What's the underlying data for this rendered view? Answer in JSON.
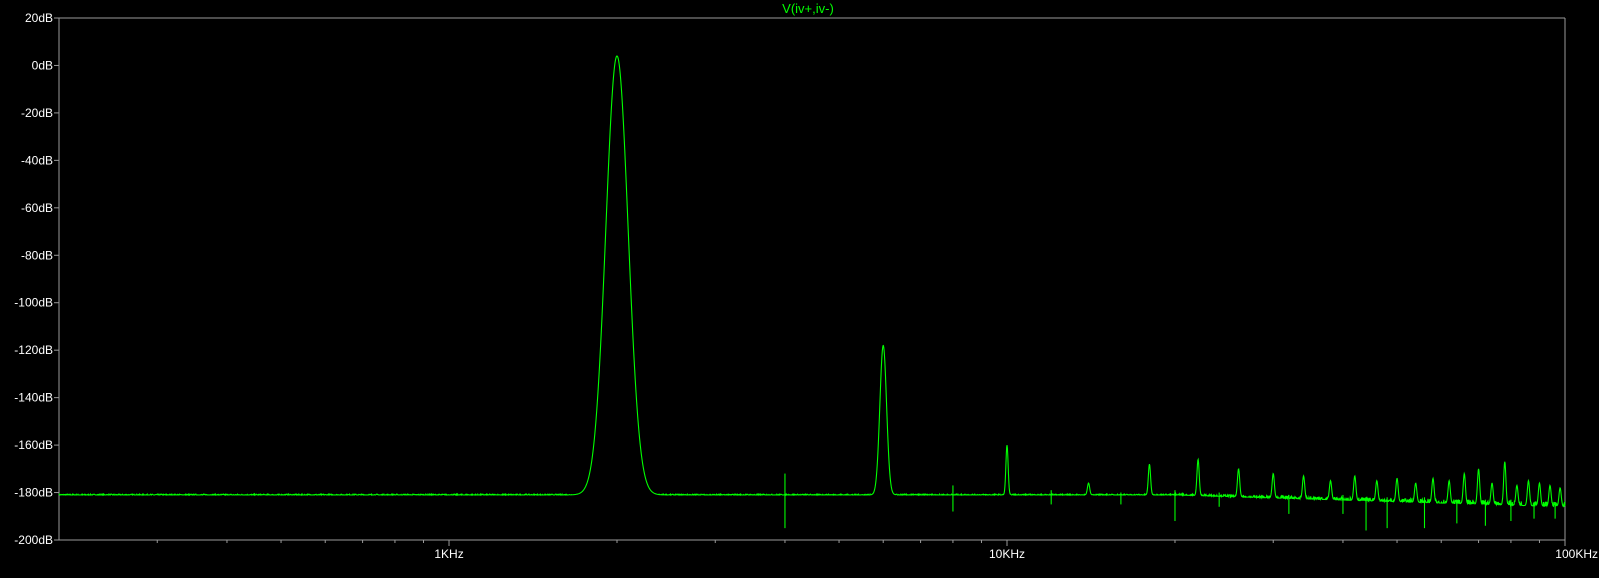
{
  "chart_data": {
    "type": "line",
    "title": "V(iv+,iv-)",
    "x_scale": "log",
    "xlim_hz": [
      200,
      100000
    ],
    "ylim_db": [
      -200,
      20
    ],
    "y_ticks": [
      {
        "value": 20,
        "label": "20dB"
      },
      {
        "value": 0,
        "label": "0dB"
      },
      {
        "value": -20,
        "label": "-20dB"
      },
      {
        "value": -40,
        "label": "-40dB"
      },
      {
        "value": -60,
        "label": "-60dB"
      },
      {
        "value": -80,
        "label": "-80dB"
      },
      {
        "value": -100,
        "label": "-100dB"
      },
      {
        "value": -120,
        "label": "-120dB"
      },
      {
        "value": -140,
        "label": "-140dB"
      },
      {
        "value": -160,
        "label": "-160dB"
      },
      {
        "value": -180,
        "label": "-180dB"
      },
      {
        "value": -200,
        "label": "-200dB"
      }
    ],
    "x_ticks": [
      {
        "value": 1000,
        "label": "1KHz"
      },
      {
        "value": 10000,
        "label": "10KHz"
      },
      {
        "value": 100000,
        "label": "100KHz"
      }
    ],
    "x_minor_ticks": [
      300,
      400,
      500,
      600,
      700,
      800,
      900,
      2000,
      3000,
      4000,
      5000,
      6000,
      7000,
      8000,
      9000,
      20000,
      30000,
      40000,
      50000,
      60000,
      70000,
      80000,
      90000
    ],
    "noise_floor_db": -181,
    "noise_floor_end_db": -186,
    "series_color": "#00ff00",
    "axis_color": "#9a9a9a",
    "label_color": "#ffffff",
    "grid": false,
    "peaks": [
      {
        "freq": 2000,
        "db": 4,
        "width": 0.02
      },
      {
        "freq": 6000,
        "db": -118,
        "width": 0.006
      },
      {
        "freq": 10000,
        "db": -160,
        "width": 0.002
      },
      {
        "freq": 14000,
        "db": -176,
        "width": 0.002
      },
      {
        "freq": 18000,
        "db": -168,
        "width": 0.002
      },
      {
        "freq": 22000,
        "db": -166,
        "width": 0.002
      },
      {
        "freq": 26000,
        "db": -170,
        "width": 0.002
      },
      {
        "freq": 30000,
        "db": -172,
        "width": 0.002
      },
      {
        "freq": 34000,
        "db": -173,
        "width": 0.002
      },
      {
        "freq": 38000,
        "db": -175,
        "width": 0.002
      },
      {
        "freq": 42000,
        "db": -173,
        "width": 0.002
      },
      {
        "freq": 46000,
        "db": -175,
        "width": 0.002
      },
      {
        "freq": 50000,
        "db": -174,
        "width": 0.002
      },
      {
        "freq": 54000,
        "db": -176,
        "width": 0.002
      },
      {
        "freq": 58000,
        "db": -174,
        "width": 0.002
      },
      {
        "freq": 62000,
        "db": -175,
        "width": 0.002
      },
      {
        "freq": 66000,
        "db": -172,
        "width": 0.002
      },
      {
        "freq": 70000,
        "db": -170,
        "width": 0.002
      },
      {
        "freq": 74000,
        "db": -176,
        "width": 0.002
      },
      {
        "freq": 78000,
        "db": -167,
        "width": 0.002
      },
      {
        "freq": 82000,
        "db": -177,
        "width": 0.002
      },
      {
        "freq": 86000,
        "db": -175,
        "width": 0.002
      },
      {
        "freq": 90000,
        "db": -176,
        "width": 0.002
      },
      {
        "freq": 94000,
        "db": -177,
        "width": 0.002
      },
      {
        "freq": 98000,
        "db": -178,
        "width": 0.002
      }
    ],
    "spurs": [
      {
        "freq": 4000,
        "db_up": -172,
        "db_down": -195
      },
      {
        "freq": 8000,
        "db_up": -177,
        "db_down": -188
      },
      {
        "freq": 12000,
        "db_up": -179,
        "db_down": -185
      },
      {
        "freq": 16000,
        "db_up": -180,
        "db_down": -185
      },
      {
        "freq": 20000,
        "db_up": -179,
        "db_down": -192
      },
      {
        "freq": 24000,
        "db_up": -180,
        "db_down": -186
      },
      {
        "freq": 32000,
        "db_up": -181,
        "db_down": -189
      },
      {
        "freq": 40000,
        "db_up": -181,
        "db_down": -189
      },
      {
        "freq": 44000,
        "db_up": -182,
        "db_down": -196
      },
      {
        "freq": 48000,
        "db_up": -182,
        "db_down": -195
      },
      {
        "freq": 56000,
        "db_up": -182,
        "db_down": -195
      },
      {
        "freq": 64000,
        "db_up": -183,
        "db_down": -193
      },
      {
        "freq": 72000,
        "db_up": -183,
        "db_down": -194
      },
      {
        "freq": 80000,
        "db_up": -183,
        "db_down": -192
      },
      {
        "freq": 88000,
        "db_up": -184,
        "db_down": -191
      },
      {
        "freq": 96000,
        "db_up": -184,
        "db_down": -191
      }
    ]
  }
}
